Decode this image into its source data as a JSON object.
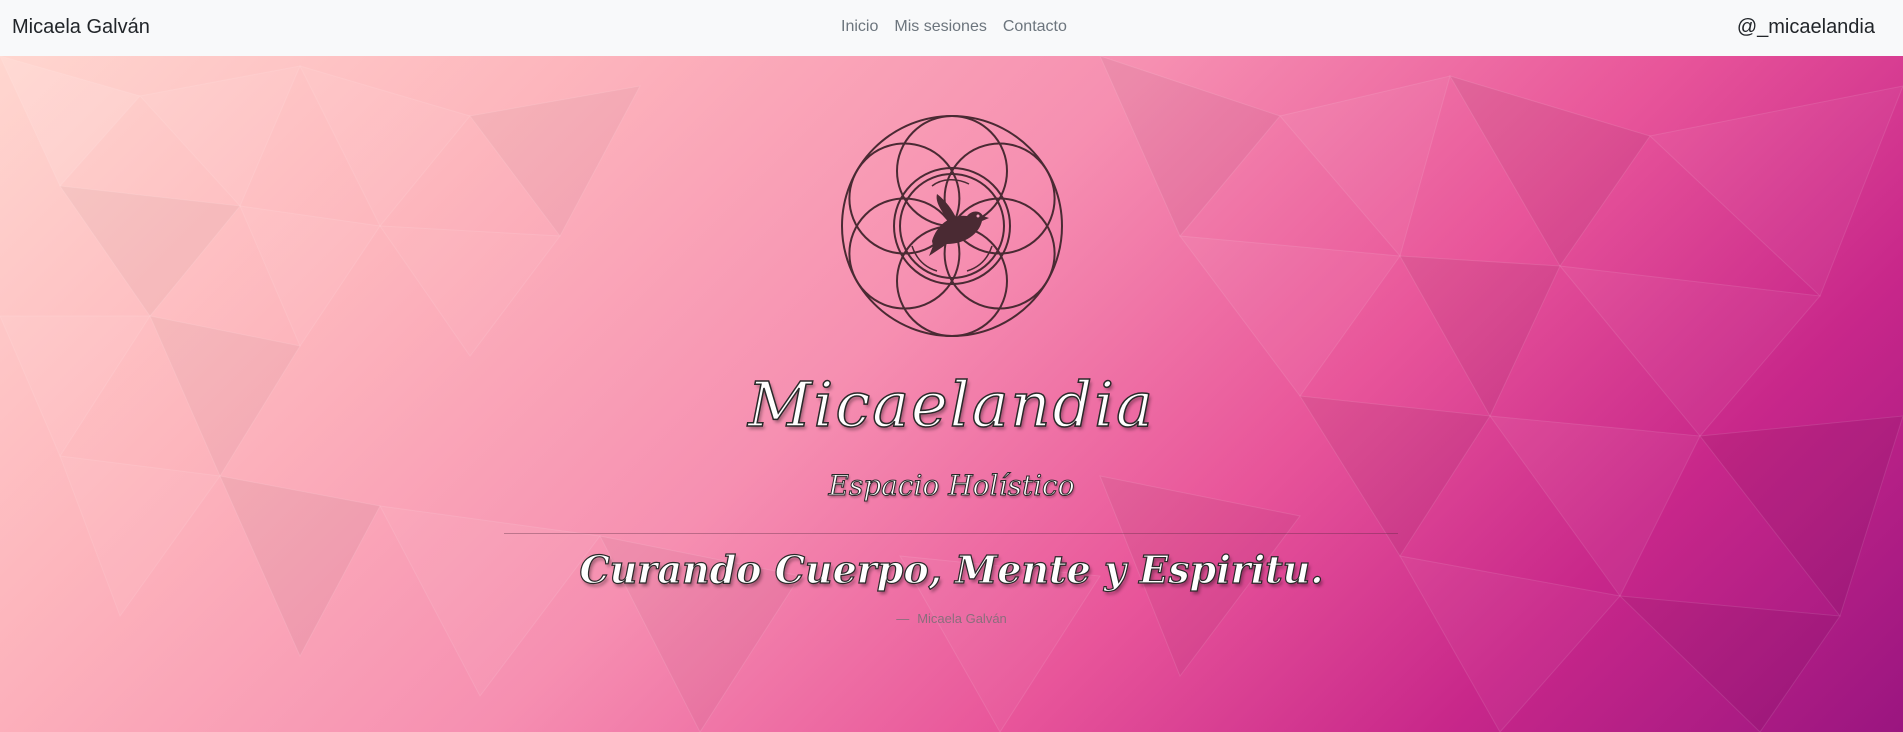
{
  "navbar": {
    "brand": "Micaela Galván",
    "links": [
      {
        "label": "Inicio"
      },
      {
        "label": "Mis sesiones"
      },
      {
        "label": "Contacto"
      }
    ],
    "handle": "@_micaelandia"
  },
  "hero": {
    "title": "Micaelandia",
    "subtitle": "Espacio Holístico",
    "quote": "Curando Cuerpo, Mente y Espiritu.",
    "author_dash": "—",
    "author": "Micaela Galván"
  },
  "colors": {
    "navbar_bg": "#f8f9fa",
    "hero_start": "#ffd6cf",
    "hero_mid": "#f68fb1",
    "hero_end": "#9a1580",
    "logo_stroke": "#4a2a33"
  },
  "icons": {
    "logo": "flower-of-life-with-dove"
  }
}
